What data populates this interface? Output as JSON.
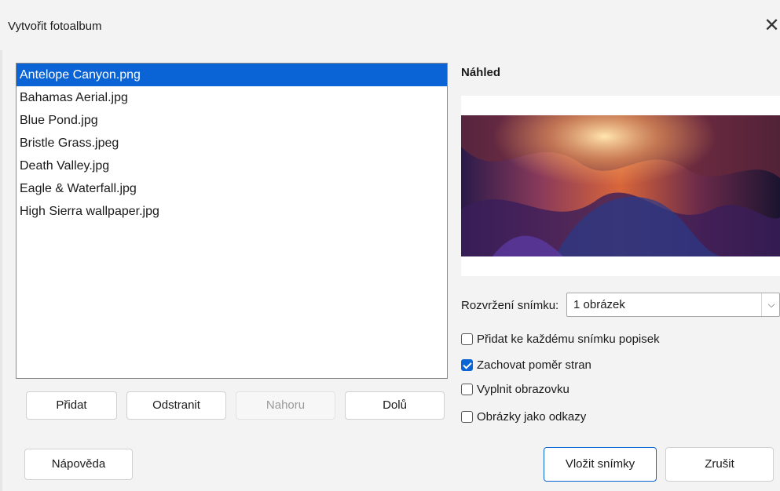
{
  "dialog": {
    "title": "Vytvořit fotoalbum",
    "close_glyph": "✕"
  },
  "files": [
    "Antelope Canyon.png",
    "Bahamas Aerial.jpg",
    "Blue Pond.jpg",
    "Bristle Grass.jpeg",
    "Death Valley.jpg",
    "Eagle & Waterfall.jpg",
    "High Sierra wallpaper.jpg"
  ],
  "selected_file_index": 0,
  "list_buttons": {
    "add": "Přidat",
    "remove": "Odstranit",
    "up": "Nahoru",
    "down": "Dolů"
  },
  "preview": {
    "label": "Náhled"
  },
  "layout": {
    "label": "Rozvržení snímku:",
    "value": "1 obrázek",
    "arrow": "⌵"
  },
  "options": {
    "caption": {
      "label": "Přidat ke každému snímku popisek",
      "checked": false
    },
    "aspect": {
      "label": "Zachovat poměr stran",
      "checked": true
    },
    "fill": {
      "label": "Vyplnit obrazovku",
      "checked": false
    },
    "links": {
      "label": "Obrázky jako odkazy",
      "checked": false
    }
  },
  "footer": {
    "help": "Nápověda",
    "insert": "Vložit snímky",
    "cancel": "Zrušit"
  },
  "colors": {
    "accent": "#0a64d6",
    "background": "#f3f3f3"
  },
  "icons": {
    "close": "close-icon",
    "dropdown": "chevron-down-icon",
    "check": "check-icon"
  }
}
